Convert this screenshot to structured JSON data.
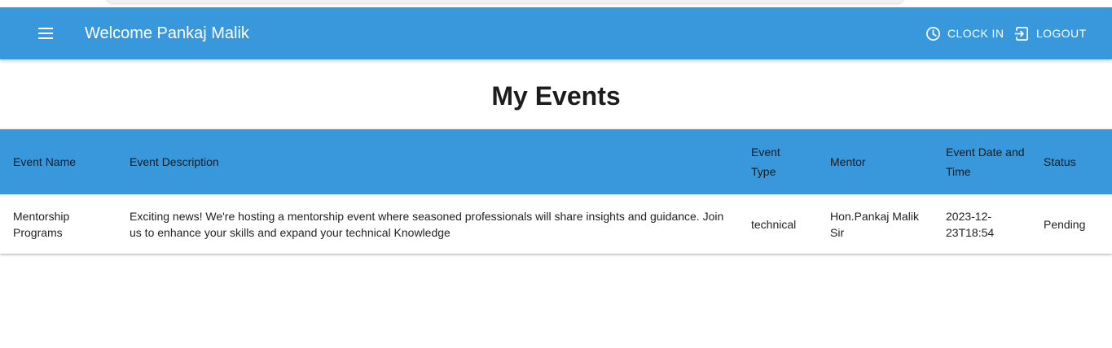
{
  "header": {
    "title": "Welcome Pankaj Malik",
    "clock_in_label": "CLOCK IN",
    "logout_label": "LOGOUT",
    "background_color": "#3898db",
    "icons": {
      "menu": "menu-icon",
      "clock": "clock-icon",
      "logout": "logout-icon"
    }
  },
  "main": {
    "title": "My Events"
  },
  "events_table": {
    "columns": [
      "Event Name",
      "Event Description",
      "Event Type",
      "Mentor",
      "Event Date and Time",
      "Status"
    ],
    "rows": [
      {
        "name": "Mentorship Programs",
        "description": "Exciting news! We're hosting a mentorship event where seasoned professionals will share insights and guidance. Join us to enhance your skills and expand your technical Knowledge",
        "type": "technical",
        "mentor": "Hon.Pankaj Malik Sir",
        "date_time": "2023-12-23T18:54",
        "status": "Pending"
      }
    ]
  }
}
